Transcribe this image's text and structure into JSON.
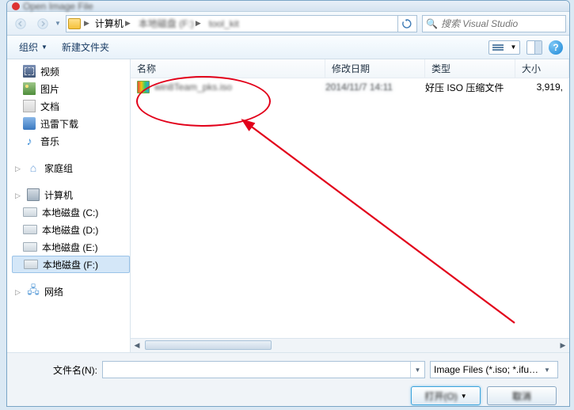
{
  "titlebar": {
    "title": "Open Image File"
  },
  "address": {
    "segs": [
      "计算机",
      "本地磁盘 (F:)",
      "tool_kit"
    ],
    "refresh_icon": "refresh-icon"
  },
  "search": {
    "placeholder": "搜索 Visual Studio"
  },
  "toolbar": {
    "organize": "组织",
    "new_folder": "新建文件夹"
  },
  "sidebar": {
    "top": [
      {
        "label": "视频",
        "icon": "video-icon"
      },
      {
        "label": "图片",
        "icon": "image-icon"
      },
      {
        "label": "文档",
        "icon": "doc-icon"
      },
      {
        "label": "迅雷下载",
        "icon": "download-icon"
      },
      {
        "label": "音乐",
        "icon": "music-icon"
      }
    ],
    "homegroup": "家庭组",
    "computer": "计算机",
    "drives": [
      "本地磁盘 (C:)",
      "本地磁盘 (D:)",
      "本地磁盘 (E:)",
      "本地磁盘 (F:)"
    ],
    "network": "网络",
    "selected_drive_index": 3
  },
  "list": {
    "columns": {
      "name": "名称",
      "date": "修改日期",
      "type": "类型",
      "size": "大小"
    },
    "rows": [
      {
        "name": "win8Team_pks.iso",
        "date": "2014/11/7 14:11",
        "type": "好压 ISO 压缩文件",
        "size": "3,919,"
      }
    ]
  },
  "footer": {
    "filename_label": "文件名(N):",
    "filename_value": "",
    "filetype": "Image Files (*.iso; *.ifu; *.bin",
    "open": "打开(O)",
    "cancel": "取消"
  }
}
